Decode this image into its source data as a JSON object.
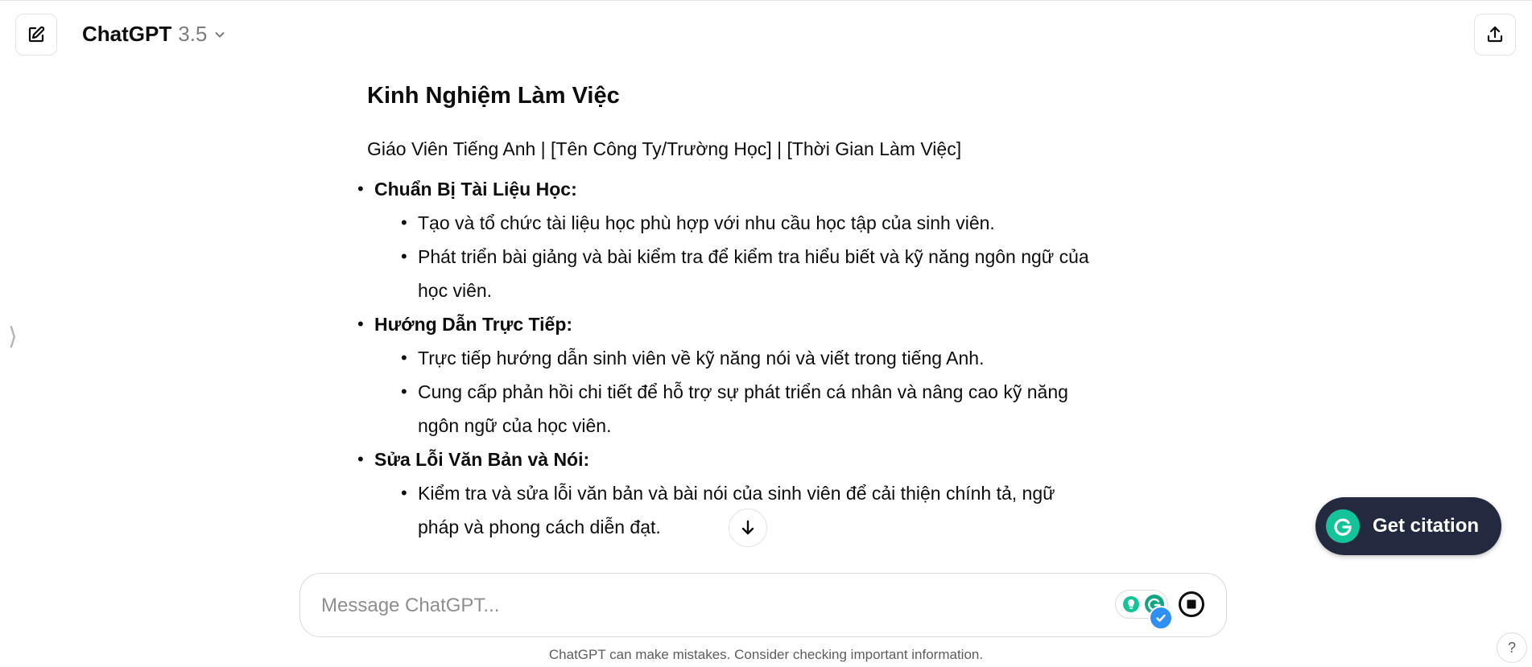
{
  "header": {
    "model_name": "ChatGPT",
    "model_version": "3.5",
    "new_chat_icon": "edit-icon",
    "share_icon": "share-icon"
  },
  "content": {
    "section_title": "Kinh Nghiệm Làm Việc",
    "subtitle": "Giáo Viên Tiếng Anh | [Tên Công Ty/Trường Học] | [Thời Gian Làm Việc]",
    "items": [
      {
        "title": "Chuẩn Bị Tài Liệu Học:",
        "subitems": [
          "Tạo và tổ chức tài liệu học phù hợp với nhu cầu học tập của sinh viên.",
          "Phát triển bài giảng và bài kiểm tra để kiểm tra hiểu biết và kỹ năng ngôn ngữ của học viên."
        ]
      },
      {
        "title": "Hướng Dẫn Trực Tiếp:",
        "subitems": [
          "Trực tiếp hướng dẫn sinh viên về kỹ năng nói và viết trong tiếng Anh.",
          "Cung cấp phản hồi chi tiết để hỗ trợ sự phát triển cá nhân và nâng cao kỹ năng ngôn ngữ của học viên."
        ]
      },
      {
        "title": "Sửa Lỗi Văn Bản và Nói:",
        "subitems": [
          "Kiểm tra và sửa lỗi văn bản và bài nói của sinh viên để cải thiện chính tả, ngữ pháp và phong cách diễn đạt."
        ]
      }
    ]
  },
  "citation": {
    "label": "Get citation"
  },
  "composer": {
    "placeholder": "Message ChatGPT...",
    "value": ""
  },
  "footer": {
    "disclaimer": "ChatGPT can make mistakes. Consider checking important information.",
    "help_label": "?"
  },
  "colors": {
    "citation_bg": "#232a40",
    "grammarly_green": "#15c39a",
    "check_blue": "#2f8ff3"
  }
}
